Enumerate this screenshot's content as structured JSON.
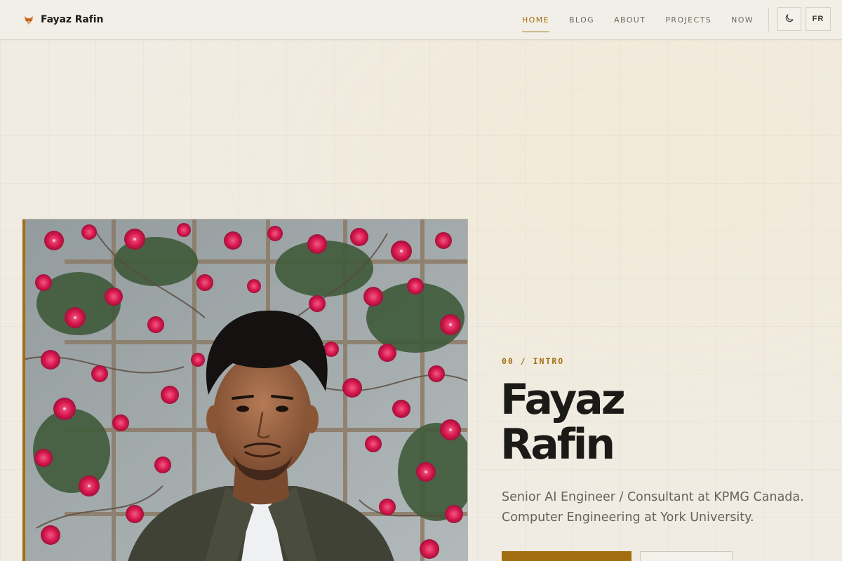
{
  "brand": {
    "name": "Fayaz Rafin",
    "logo_icon": "fox-icon"
  },
  "nav": {
    "items": [
      {
        "label": "HOME",
        "active": true
      },
      {
        "label": "BLOG",
        "active": false
      },
      {
        "label": "ABOUT",
        "active": false
      },
      {
        "label": "PROJECTS",
        "active": false
      },
      {
        "label": "NOW",
        "active": false
      }
    ],
    "theme_toggle_icon": "moon-icon",
    "language_toggle": "FR"
  },
  "hero": {
    "eyebrow": "00 / INTRO",
    "name_line_1": "Fayaz",
    "name_line_2": "Rafin",
    "tagline_line_1": "Senior AI Engineer / Consultant at KPMG Canada.",
    "tagline_line_2": "Computer Engineering at York University.",
    "portrait_alt": "Portrait in front of pink bougainvillea flowers"
  },
  "colors": {
    "accent": "#a26e10",
    "background": "#f0ece3",
    "text": "#1e1b17",
    "muted": "#67625a",
    "flower_pink": "#d8194f"
  }
}
